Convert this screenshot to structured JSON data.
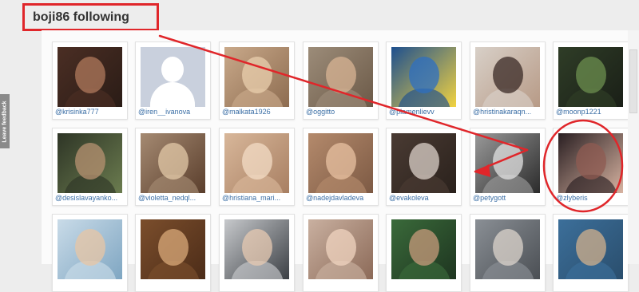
{
  "page": {
    "title": "boji86 following"
  },
  "feedback_tab": {
    "label": "Leave feedback"
  },
  "grid": {
    "rows": [
      [
        {
          "username": "@krisinka777",
          "colors": [
            "#4b2e24",
            "#b07a5c",
            "#2a1c16"
          ]
        },
        {
          "username": "@iren__ivanova",
          "placeholder": true,
          "colors": [
            "#c9d0dd",
            "#ffffff",
            "#c9d0dd"
          ]
        },
        {
          "username": "@malkata1926",
          "colors": [
            "#c9a98a",
            "#e9cfae",
            "#8d6c50"
          ]
        },
        {
          "username": "@oggitto",
          "colors": [
            "#9c8c79",
            "#d8b494",
            "#6c5a48"
          ]
        },
        {
          "username": "@plamenlievv",
          "colors": [
            "#1d4f8f",
            "#2d6fc2",
            "#f2d341"
          ]
        },
        {
          "username": "@hristinakaraqn...",
          "colors": [
            "#d8d0c8",
            "#3a2a25",
            "#b79a86"
          ]
        },
        {
          "username": "@moonp1221",
          "colors": [
            "#2f3d27",
            "#6c8f4f",
            "#1a1f17"
          ]
        }
      ],
      [
        {
          "username": "@desislavayanko...",
          "colors": [
            "#2e3526",
            "#b79272",
            "#6b7c4f"
          ]
        },
        {
          "username": "@violetta_nedql...",
          "colors": [
            "#a58a72",
            "#e3c9a8",
            "#5a3e2c"
          ]
        },
        {
          "username": "@hristiana_mari...",
          "colors": [
            "#d8b79a",
            "#f3dcc5",
            "#a87f62"
          ]
        },
        {
          "username": "@nadejdavladeva",
          "colors": [
            "#b48a6c",
            "#e8c2a1",
            "#7d5a44"
          ]
        },
        {
          "username": "@evakoleva",
          "colors": [
            "#4a3b33",
            "#dcd2c9",
            "#2a211c"
          ]
        },
        {
          "username": "@petygott",
          "colors": [
            "#999999",
            "#e2e2e2",
            "#2b2b2b"
          ]
        },
        {
          "username": "@zlyberis",
          "colors": [
            "#2a1f22",
            "#8f5b52",
            "#d7b3a1"
          ]
        }
      ],
      [
        {
          "username": "",
          "colors": [
            "#c9dbe8",
            "#e8c6a4",
            "#7fa6c2"
          ]
        },
        {
          "username": "",
          "colors": [
            "#7b4e2c",
            "#d9a97a",
            "#4c2c18"
          ]
        },
        {
          "username": "",
          "colors": [
            "#c7c9cc",
            "#e7c9b2",
            "#3b3f44"
          ]
        },
        {
          "username": "",
          "colors": [
            "#c9b0a0",
            "#f0d4c0",
            "#8c6a58"
          ]
        },
        {
          "username": "",
          "colors": [
            "#3a6a3a",
            "#c89b7c",
            "#1e3520"
          ]
        },
        {
          "username": "",
          "colors": [
            "#8a8f95",
            "#dcd4cc",
            "#4b4f54"
          ]
        },
        {
          "username": "",
          "colors": [
            "#3c6f9a",
            "#d1b08c",
            "#2a4e6d"
          ]
        }
      ]
    ]
  },
  "annotations": {
    "color": "#e0262a"
  }
}
